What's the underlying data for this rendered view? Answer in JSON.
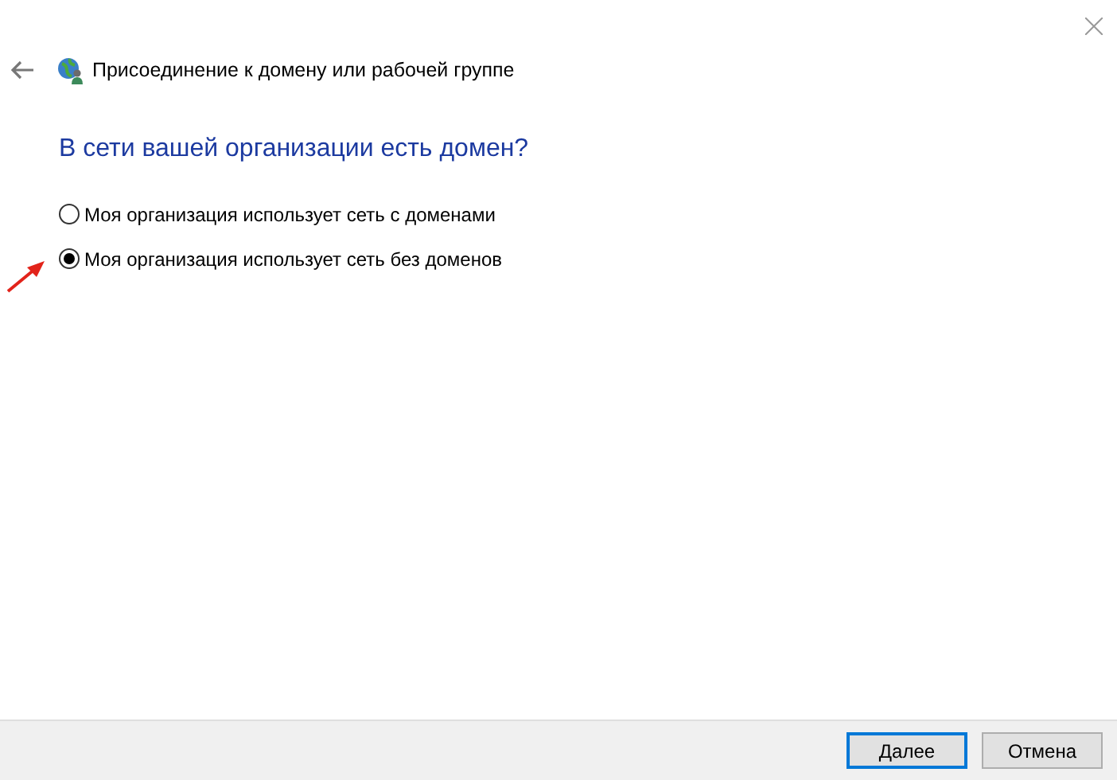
{
  "window": {
    "title": "Присоединение к домену или рабочей группе"
  },
  "heading": "В сети вашей организации есть домен?",
  "options": [
    {
      "label": "Моя организация использует сеть с доменами",
      "selected": false
    },
    {
      "label": "Моя организация использует сеть без доменов",
      "selected": true
    }
  ],
  "buttons": [
    {
      "label": "Далее",
      "default": true
    },
    {
      "label": "Отмена",
      "default": false
    }
  ]
}
